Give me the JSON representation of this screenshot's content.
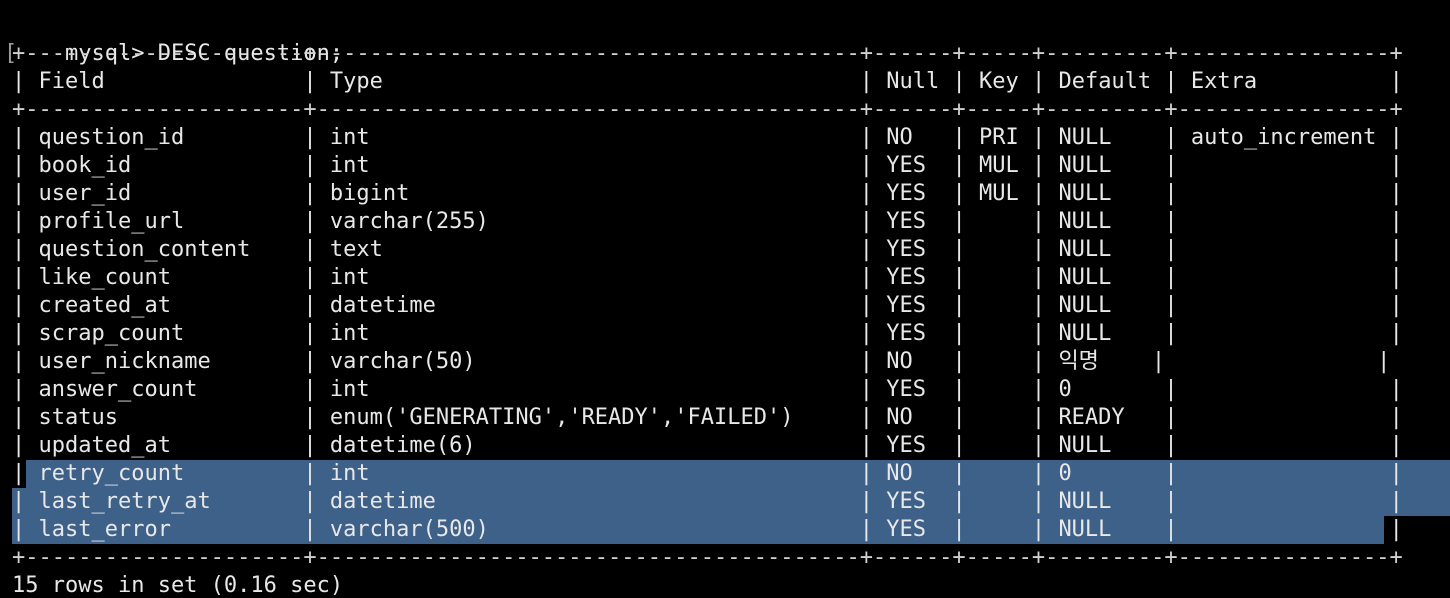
{
  "prompt": {
    "bracket": "[",
    "command": "mysql> DESC question;"
  },
  "table": {
    "border": "+---------------------+-----------------------------------------+------+-----+---------+----------------+",
    "headers": [
      "Field",
      "Type",
      "Null",
      "Key",
      "Default",
      "Extra"
    ],
    "rows": [
      [
        "question_id",
        "int",
        "NO",
        "PRI",
        "NULL",
        "auto_increment"
      ],
      [
        "book_id",
        "int",
        "YES",
        "MUL",
        "NULL",
        ""
      ],
      [
        "user_id",
        "bigint",
        "YES",
        "MUL",
        "NULL",
        ""
      ],
      [
        "profile_url",
        "varchar(255)",
        "YES",
        "",
        "NULL",
        ""
      ],
      [
        "question_content",
        "text",
        "YES",
        "",
        "NULL",
        ""
      ],
      [
        "like_count",
        "int",
        "YES",
        "",
        "NULL",
        ""
      ],
      [
        "created_at",
        "datetime",
        "YES",
        "",
        "NULL",
        ""
      ],
      [
        "scrap_count",
        "int",
        "YES",
        "",
        "NULL",
        ""
      ],
      [
        "user_nickname",
        "varchar(50)",
        "NO",
        "",
        "익명",
        ""
      ],
      [
        "answer_count",
        "int",
        "YES",
        "",
        "0",
        ""
      ],
      [
        "status",
        "enum('GENERATING','READY','FAILED')",
        "NO",
        "",
        "READY",
        ""
      ],
      [
        "updated_at",
        "datetime(6)",
        "YES",
        "",
        "NULL",
        ""
      ],
      [
        "retry_count",
        "int",
        "NO",
        "",
        "0",
        ""
      ],
      [
        "last_retry_at",
        "datetime",
        "YES",
        "",
        "NULL",
        ""
      ],
      [
        "last_error",
        "varchar(500)",
        "YES",
        "",
        "NULL",
        ""
      ]
    ],
    "highlighted_rows": [
      12,
      13,
      14
    ]
  },
  "footer": "15 rows in set (0.16 sec)",
  "colors": {
    "background": "#000000",
    "text": "#e8e8e8",
    "selection": "#3e6189"
  }
}
